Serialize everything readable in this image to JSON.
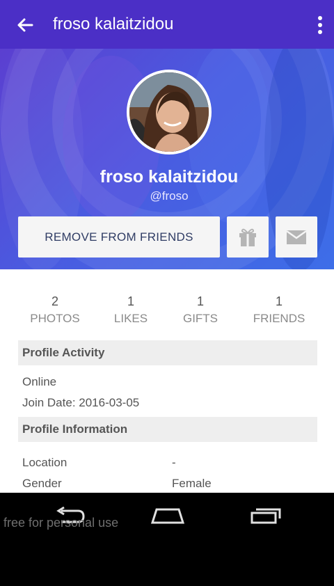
{
  "appbar": {
    "title": "froso kalaitzidou"
  },
  "profile": {
    "name": "froso kalaitzidou",
    "handle": "@froso",
    "remove_label": "REMOVE FROM FRIENDS"
  },
  "stats": [
    {
      "count": "2",
      "label": "PHOTOS"
    },
    {
      "count": "1",
      "label": "LIKES"
    },
    {
      "count": "1",
      "label": "GIFTS"
    },
    {
      "count": "1",
      "label": "FRIENDS"
    }
  ],
  "activity": {
    "title": "Profile Activity",
    "status": "Online",
    "join_date": "Join Date: 2016-03-05"
  },
  "information": {
    "title": "Profile Information",
    "location_label": "Location",
    "location_value": "-",
    "gender_label": "Gender",
    "gender_value": "Female"
  },
  "watermark": "free for personal use",
  "colors": {
    "accent": "#4b2fc6",
    "hero": "#4a5be0"
  },
  "icons": [
    "back-arrow-icon",
    "overflow-menu-icon",
    "gift-icon",
    "mail-icon",
    "nav-back-icon",
    "nav-home-icon",
    "nav-recents-icon"
  ]
}
